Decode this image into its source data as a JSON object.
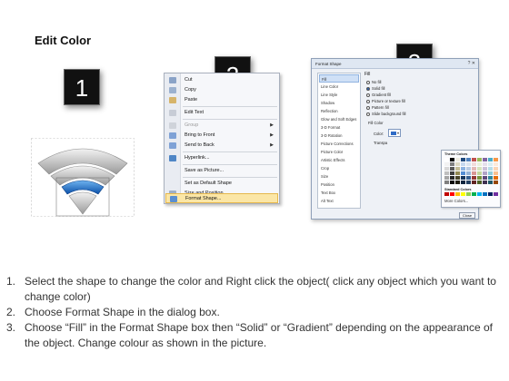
{
  "page": {
    "title": "Edit Color"
  },
  "badges": [
    "1",
    "2",
    "3"
  ],
  "colors": {
    "accent": "#2f6bc6",
    "badge": "#111111",
    "highlight": "#fbe6a6"
  },
  "context_menu": {
    "items": [
      {
        "label": "Cut",
        "icon": "scissors-icon",
        "enabled": true
      },
      {
        "label": "Copy",
        "icon": "copy-icon",
        "enabled": true
      },
      {
        "label": "Paste",
        "icon": "paste-icon",
        "enabled": true
      },
      {
        "label": "Edit Text",
        "icon": "edit-text-icon",
        "enabled": true
      },
      {
        "label": "Group",
        "icon": "group-icon",
        "enabled": false,
        "submenu": true
      },
      {
        "label": "Bring to Front",
        "icon": "bring-front-icon",
        "enabled": true,
        "submenu": true
      },
      {
        "label": "Send to Back",
        "icon": "send-back-icon",
        "enabled": true,
        "submenu": true
      },
      {
        "label": "Hyperlink...",
        "icon": "hyperlink-icon",
        "enabled": true
      },
      {
        "label": "Save as Picture...",
        "icon": "",
        "enabled": true
      },
      {
        "label": "Set as Default Shape",
        "icon": "",
        "enabled": true
      },
      {
        "label": "Size and Position...",
        "icon": "size-position-icon",
        "enabled": true
      },
      {
        "label": "Format Shape...",
        "icon": "format-shape-icon",
        "enabled": true,
        "highlighted": true
      }
    ]
  },
  "dialog": {
    "title": "Format Shape",
    "nav": [
      "Fill",
      "Line Color",
      "Line Style",
      "Shadow",
      "Reflection",
      "Glow and Soft Edges",
      "3-D Format",
      "3-D Rotation",
      "Picture Corrections",
      "Picture Color",
      "Artistic Effects",
      "Crop",
      "Size",
      "Position",
      "Text Box",
      "Alt Text"
    ],
    "selected_nav": "Fill",
    "fill_heading": "Fill",
    "options": [
      {
        "label": "No fill",
        "checked": false
      },
      {
        "label": "Solid fill",
        "checked": true
      },
      {
        "label": "Gradient fill",
        "checked": false
      },
      {
        "label": "Picture or texture fill",
        "checked": false
      },
      {
        "label": "Pattern fill",
        "checked": false
      },
      {
        "label": "Slide background fill",
        "checked": false
      }
    ],
    "fill_color_heading": "Fill Color",
    "color_label": "Color:",
    "transparency_label": "Transpa",
    "palette": {
      "theme_heading": "Theme Colors",
      "standard_heading": "Standard Colors",
      "more_label": "More Colors...",
      "theme_rows": [
        [
          "#ffffff",
          "#000000",
          "#eeece1",
          "#1f497d",
          "#4f81bd",
          "#c0504d",
          "#9bbb59",
          "#8064a2",
          "#4bacc6",
          "#f79646"
        ],
        [
          "#f2f2f2",
          "#7f7f7f",
          "#ddd9c3",
          "#c6d9f0",
          "#dbe5f1",
          "#f2dcdb",
          "#ebf1dd",
          "#e5e0ec",
          "#dbeef3",
          "#fdeada"
        ],
        [
          "#d8d8d8",
          "#595959",
          "#c4bd97",
          "#8db3e2",
          "#b8cce4",
          "#e5b9b7",
          "#d7e3bc",
          "#ccc1d9",
          "#b7dde8",
          "#fbd5b5"
        ],
        [
          "#bfbfbf",
          "#3f3f3f",
          "#938953",
          "#548dd4",
          "#95b3d7",
          "#d99694",
          "#c3d69b",
          "#b2a2c7",
          "#92cddc",
          "#fac08f"
        ],
        [
          "#a5a5a5",
          "#262626",
          "#494429",
          "#17365d",
          "#366092",
          "#953734",
          "#76923c",
          "#5f497a",
          "#31859b",
          "#e36c09"
        ],
        [
          "#7f7f7f",
          "#0c0c0c",
          "#1d1b10",
          "#0f243e",
          "#244061",
          "#632423",
          "#4f6128",
          "#3f3151",
          "#205867",
          "#974806"
        ]
      ],
      "standard": [
        "#c00000",
        "#ff0000",
        "#ffc000",
        "#ffff00",
        "#92d050",
        "#00b050",
        "#00b0f0",
        "#0070c0",
        "#002060",
        "#7030a0"
      ]
    },
    "close_label": "Close"
  },
  "instructions": [
    {
      "num": "1.",
      "text": "Select the shape to change the color and Right click the object( click any object which you want to change color)"
    },
    {
      "num": "2.",
      "text": "Choose Format Shape in the dialog box."
    },
    {
      "num": "3.",
      "text": "Choose “Fill” in the Format Shape box then “Solid” or “Gradient” depending on the appearance of the object. Change colour as shown in the picture."
    }
  ]
}
